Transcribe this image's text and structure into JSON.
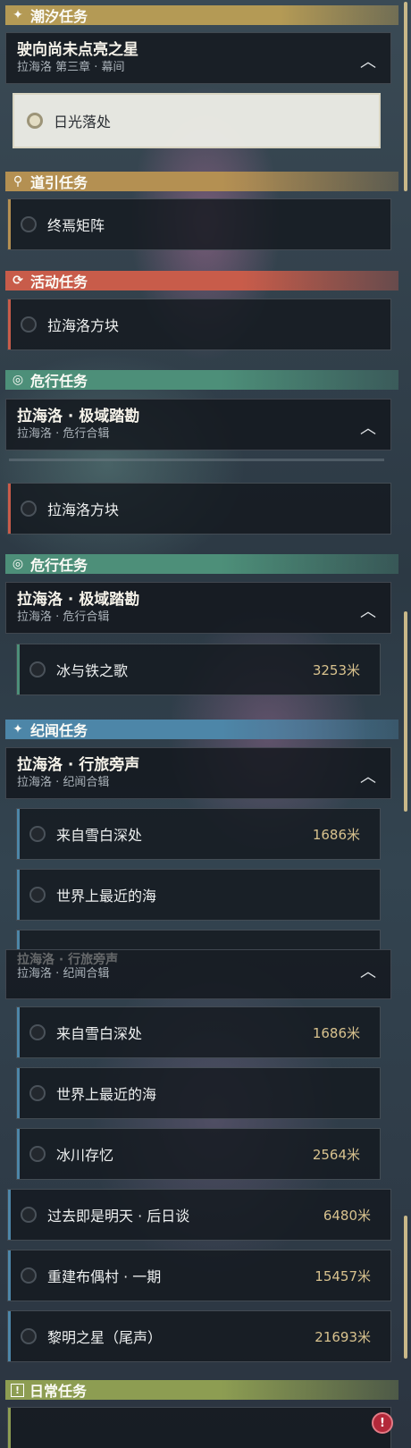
{
  "colors": {
    "tide": "#b49a55",
    "guide": "#b49052",
    "event": "#c85c4a",
    "danger": "#4d8f79",
    "lore": "#4d86a8",
    "daily": "#8d9d52",
    "distance": "#d8c28e"
  },
  "sections": {
    "tide": {
      "icon": "sparkle-icon",
      "title": "潮汐任务"
    },
    "guide": {
      "icon": "pin-icon",
      "title": "道引任务"
    },
    "event": {
      "icon": "event-icon",
      "title": "活动任务"
    },
    "danger1": {
      "icon": "shield-icon",
      "title": "危行任务"
    },
    "danger2": {
      "icon": "shield-icon",
      "title": "危行任务"
    },
    "lore": {
      "icon": "sparkle-icon",
      "title": "纪闻任务"
    },
    "daily": {
      "icon": "exclamation-icon",
      "title": "日常任务"
    }
  },
  "groups": {
    "tide": {
      "title": "驶向尚未点亮之星",
      "subtitle": "拉海洛 第三章 · 幕间"
    },
    "danger1": {
      "title": "拉海洛 · 极域踏勘",
      "subtitle": "拉海洛 · 危行合辑"
    },
    "danger2": {
      "title": "拉海洛 · 极域踏勘",
      "subtitle": "拉海洛 · 危行合辑"
    },
    "lore1": {
      "title": "拉海洛 · 行旅旁声",
      "subtitle": "拉海洛 · 纪闻合辑"
    },
    "lore2": {
      "title": "拉海洛 · 行旅旁声",
      "subtitle": "拉海洛 · 纪闻合辑"
    }
  },
  "items": {
    "sunset": {
      "name": "日光落处"
    },
    "matrix": {
      "name": "终焉矩阵"
    },
    "cube1": {
      "name": "拉海洛方块"
    },
    "cube2": {
      "name": "拉海洛方块"
    },
    "iceiron": {
      "name": "冰与铁之歌",
      "distance": "3253米"
    },
    "snow1": {
      "name": "来自雪白深处",
      "distance": "1686米"
    },
    "sea1": {
      "name": "世界上最近的海"
    },
    "snow2": {
      "name": "来自雪白深处",
      "distance": "1686米"
    },
    "sea2": {
      "name": "世界上最近的海"
    },
    "glacier": {
      "name": "冰川存忆",
      "distance": "2564米"
    },
    "past": {
      "name": "过去即是明天 · 后日谈",
      "distance": "6480米"
    },
    "doll": {
      "name": "重建布偶村 · 一期",
      "distance": "15457米"
    },
    "dawn": {
      "name": "黎明之星（尾声）",
      "distance": "21693米"
    }
  },
  "warning_badge": "!"
}
